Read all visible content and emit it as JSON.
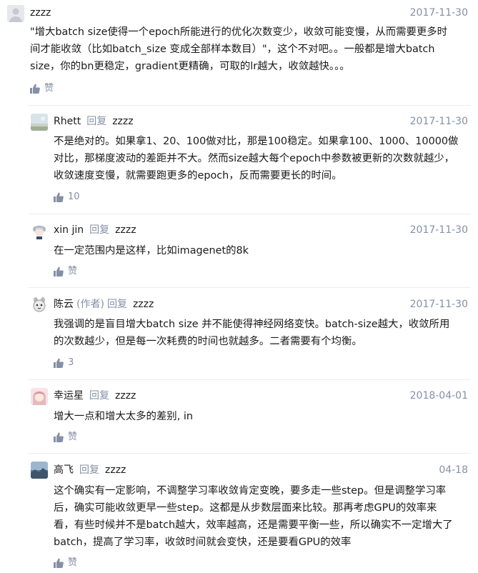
{
  "comments": [
    {
      "author": "zzzz",
      "date": "2017-11-30",
      "text_lines": [
        "\"增大batch size使得一个epoch所能进行的优化次数变少，收敛可能变慢，从而需要更多时",
        "间才能收敛（比如batch_size 变成全部样本数目）\"，这个不对吧。。一般都是增大batch",
        "size，你的bn更稳定，gradient更精确，可取的lr越大，收敛越快。。。"
      ],
      "like": "赞"
    },
    {
      "author": "Rhett",
      "reply_label": "回复",
      "reply_to": "zzzz",
      "date": "2017-11-30",
      "text_lines": [
        "不是绝对的。如果拿1、20、100做对比，那是100稳定。如果拿100、1000、10000做",
        "对比，那梯度波动的差距并不大。然而size越大每个epoch中参数被更新的次数就越少，",
        "收敛速度变慢，就需要跑更多的epoch，反而需要更长的时间。"
      ],
      "like": "10"
    },
    {
      "author": "xin jin",
      "reply_label": "回复",
      "reply_to": "zzzz",
      "date": "2017-11-30",
      "text_lines": [
        "在一定范围内是这样，比如imagenet的8k"
      ],
      "like": "赞"
    },
    {
      "author": "陈云",
      "role": "(作者)",
      "reply_label": "回复",
      "reply_to": "zzzz",
      "date": "2017-11-30",
      "text_lines": [
        "我强调的是盲目增大batch size 并不能使得神经网络变快。batch-size越大，收敛所用",
        "的次数越少，但是每一次耗费的时间也就越多。二者需要有个均衡。"
      ],
      "like": "3"
    },
    {
      "author": "幸运星",
      "reply_label": "回复",
      "reply_to": "zzzz",
      "date": "2018-04-01",
      "text_lines": [
        "增大一点和增大太多的差别, in"
      ],
      "like": "赞"
    },
    {
      "author": "高飞",
      "reply_label": "回复",
      "reply_to": "zzzz",
      "date": "04-18",
      "text_lines": [
        "这个确实有一定影响，不调整学习率收敛肯定变晚，要多走一些step。但是调整学习率",
        "后，确实可能收敛更早一些step。这都是从步数层面来比较。那再考虑GPU的效率来",
        "看，有些时候并不是batch越大，效率越高，还是需要平衡一些，所以确实不一定增大了",
        "batch，提高了学习率，收敛时间就会变快，还是要看GPU的效率"
      ],
      "like": "赞"
    }
  ],
  "colors": {
    "meta": "#8590a6",
    "text": "#1a1a1a",
    "divider": "#ececec"
  }
}
